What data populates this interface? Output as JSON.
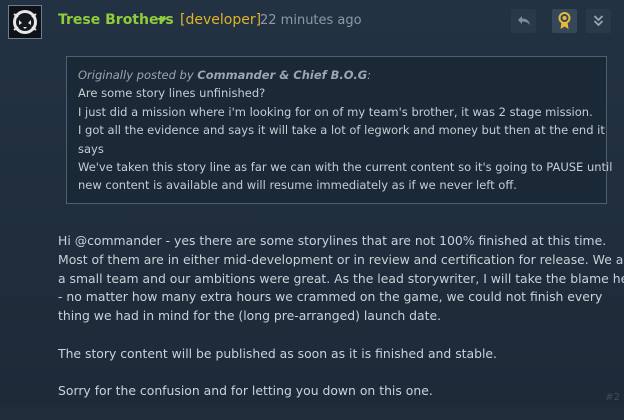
{
  "post": {
    "author": "Trese Brothers",
    "developer_tag": "[developer]",
    "timestamp": "22 minutes ago",
    "post_number": "#2"
  },
  "actions": {
    "reply_icon": "reply-arrow-icon",
    "award_icon": "award-ribbon-icon",
    "more_icon": "double-chevron-down-icon",
    "award_color": "#e8b838"
  },
  "quote": {
    "prefix": "Originally posted by",
    "author": "Commander & Chief B.O.G",
    "lines": [
      "Are some story lines unfinished?",
      "I just did a mission where i'm looking for on of my team's brother, it was 2 stage mission.",
      "I got all the evidence and says it will take a lot of legwork and money but then at the end it",
      "says",
      "We've taken this story line as far we can with the current content so it's going to PAUSE until",
      "new content is available and will resume immediately as if we never left off."
    ]
  },
  "body": {
    "paragraph1": [
      "Hi @commander - yes there are some storylines that are not 100% finished at this time.",
      "Most of them are in either mid-development or in review and certification for release. We are",
      "a small team and our ambitions were great. As the lead storywriter, I will take the blame here",
      "- no matter how many extra hours we crammed on the game, we could not finish every",
      "thing we had in mind for the (long pre-arranged) launch date."
    ],
    "paragraph2": "The story content will be published as soon as it is finished and stable.",
    "paragraph3": "Sorry for the confusion and for letting you down on this one."
  },
  "colors": {
    "author": "#8fcd3a",
    "developer_tag": "#e0b428",
    "background": "#1f2c3a"
  }
}
